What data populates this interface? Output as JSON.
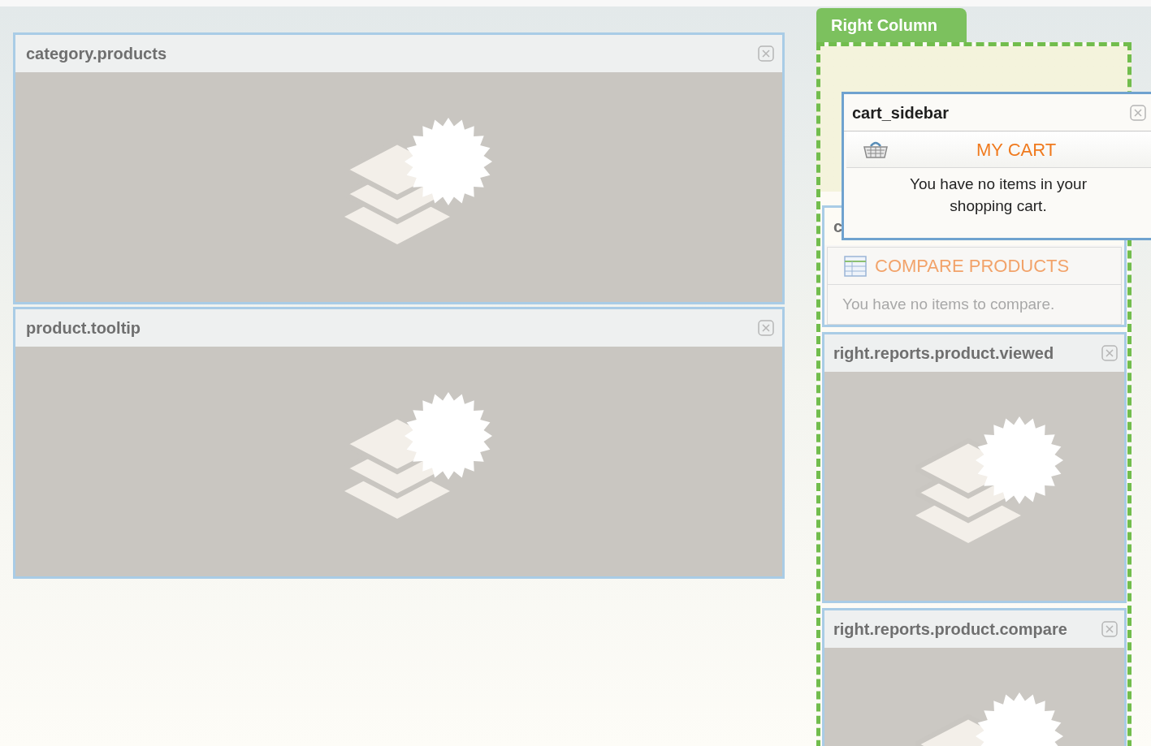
{
  "left_blocks": [
    {
      "title": "category.products"
    },
    {
      "title": "product.tooltip"
    }
  ],
  "right_column": {
    "label": "Right Column",
    "blocks": [
      {
        "kind": "compare",
        "title": "c",
        "heading": "COMPARE PRODUCTS",
        "message": "You have no items to compare."
      },
      {
        "kind": "preview",
        "title": "right.reports.product.viewed"
      },
      {
        "kind": "preview",
        "title": "right.reports.product.compare"
      }
    ]
  },
  "dragged_block": {
    "title": "cart_sidebar",
    "heading": "MY CART",
    "message": "You have no items in your shopping cart."
  }
}
